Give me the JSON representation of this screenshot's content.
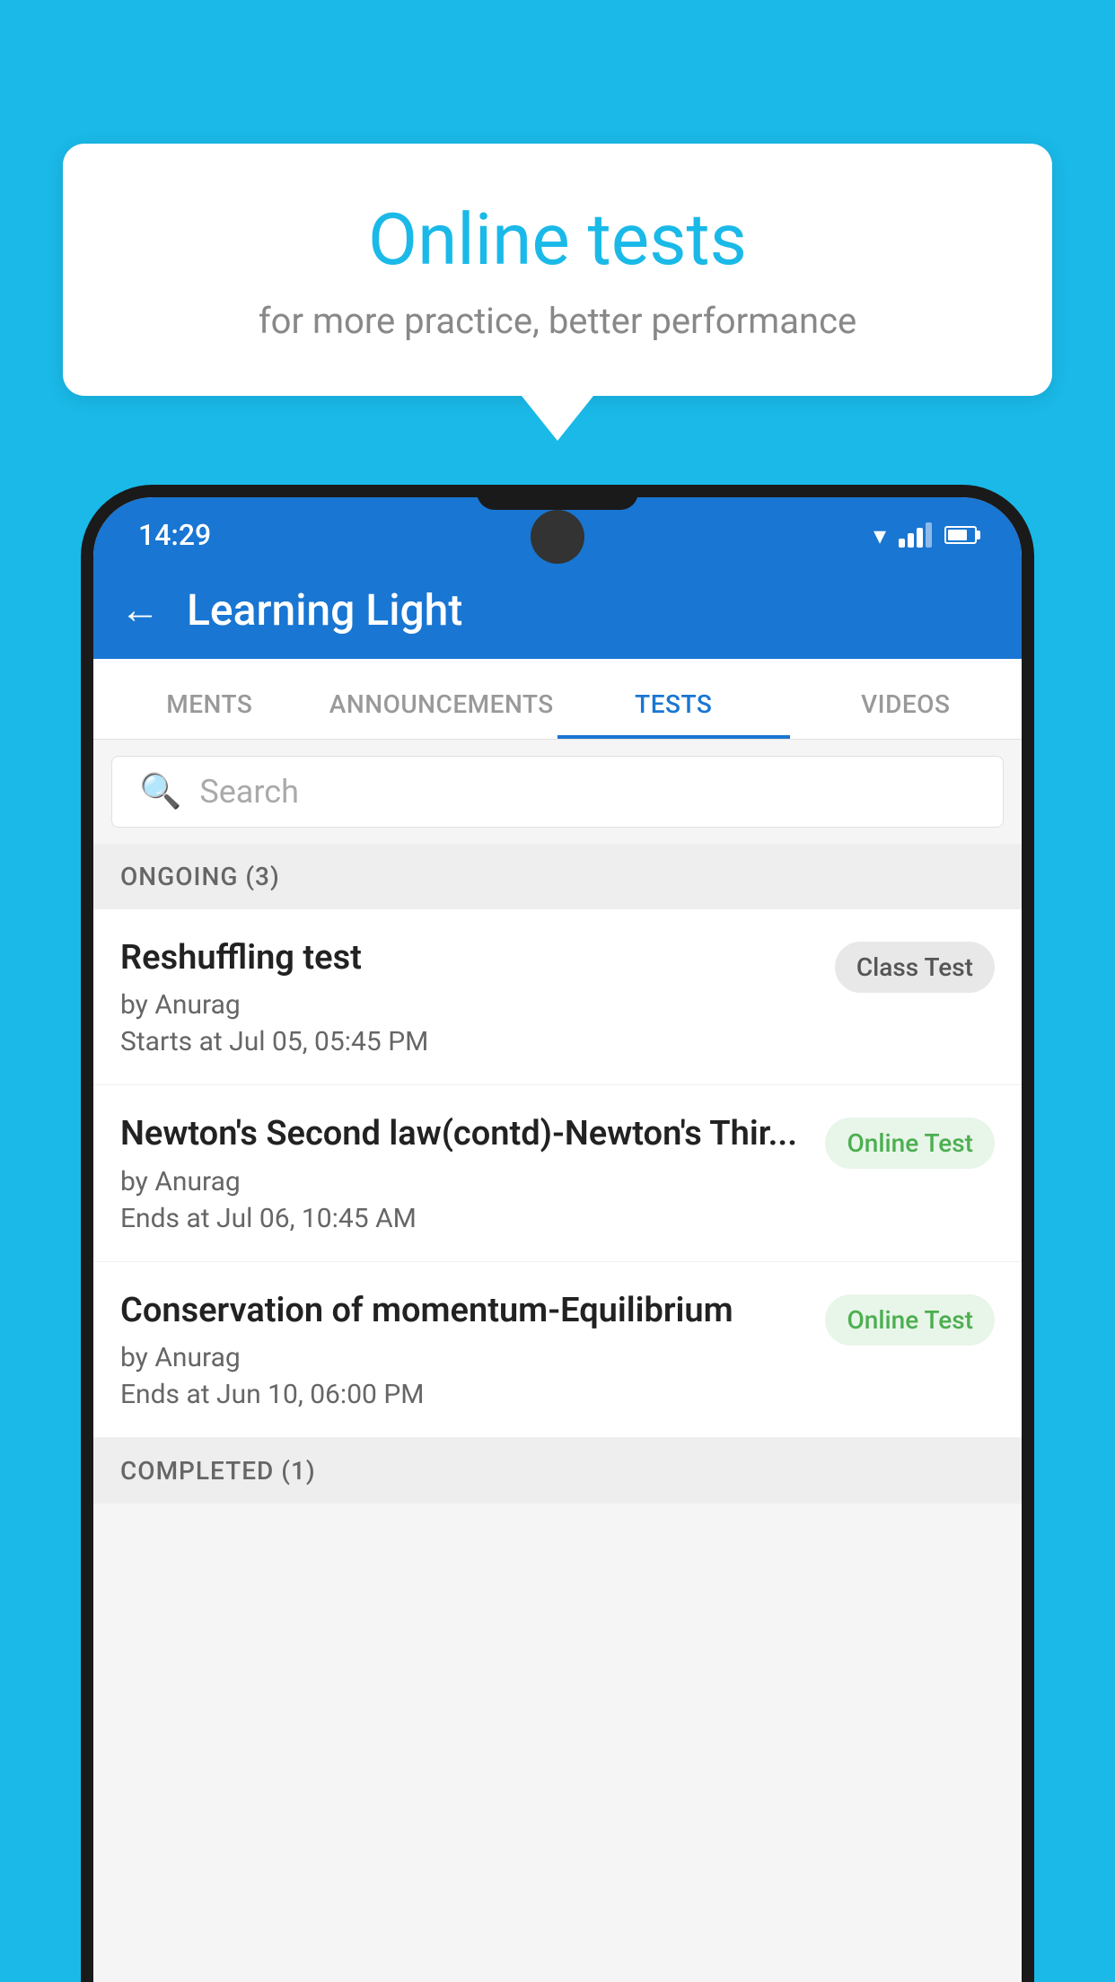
{
  "background": {
    "color": "#1ab9e8"
  },
  "speech_bubble": {
    "title": "Online tests",
    "subtitle": "for more practice, better performance"
  },
  "phone": {
    "status_bar": {
      "time": "14:29"
    },
    "app_bar": {
      "title": "Learning Light",
      "back_label": "←"
    },
    "tabs": [
      {
        "label": "MENTS",
        "active": false
      },
      {
        "label": "ANNOUNCEMENTS",
        "active": false
      },
      {
        "label": "TESTS",
        "active": true
      },
      {
        "label": "VIDEOS",
        "active": false
      }
    ],
    "search": {
      "placeholder": "Search"
    },
    "ongoing_section": {
      "label": "ONGOING (3)"
    },
    "test_items": [
      {
        "title": "Reshuffling test",
        "author": "by Anurag",
        "date": "Starts at  Jul 05, 05:45 PM",
        "badge": "Class Test",
        "badge_type": "class"
      },
      {
        "title": "Newton's Second law(contd)-Newton's Thir...",
        "author": "by Anurag",
        "date": "Ends at  Jul 06, 10:45 AM",
        "badge": "Online Test",
        "badge_type": "online"
      },
      {
        "title": "Conservation of momentum-Equilibrium",
        "author": "by Anurag",
        "date": "Ends at  Jun 10, 06:00 PM",
        "badge": "Online Test",
        "badge_type": "online"
      }
    ],
    "completed_section": {
      "label": "COMPLETED (1)"
    }
  }
}
